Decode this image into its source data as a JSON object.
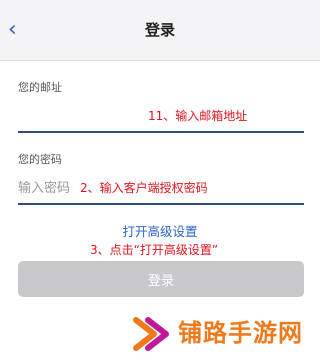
{
  "header": {
    "back_icon": "chevron-left-icon",
    "title": "登录"
  },
  "email": {
    "label": "您的邮址",
    "value": "",
    "placeholder": "",
    "annotation": "11、输入邮箱地址"
  },
  "password": {
    "label": "您的密码",
    "placeholder": "输入密码",
    "annotation": "2、输入客户端授权密码"
  },
  "advanced": {
    "link_label": "打开高级设置",
    "annotation": "3、点击“打开高级设置”"
  },
  "login_button": {
    "label": "登录"
  },
  "watermark": {
    "text": "铺路手游网"
  },
  "colors": {
    "accent": "#2a66c8",
    "annotation": "#e0141c",
    "button_disabled": "#c9c9cc",
    "watermark": "#f07a1b"
  }
}
